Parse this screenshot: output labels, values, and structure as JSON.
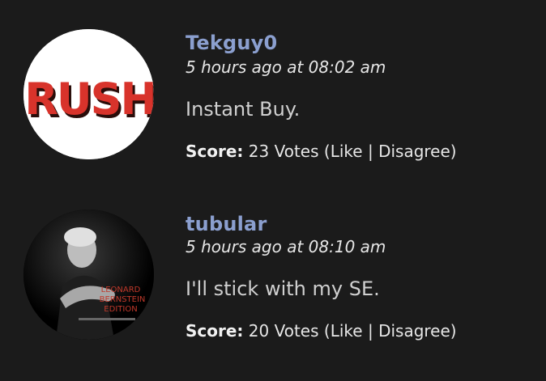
{
  "comments": [
    {
      "username": "Tekguy0",
      "timestamp": "5 hours ago at 08:02 am",
      "body": "Instant Buy.",
      "score_label": "Score:",
      "votes": "23 Votes",
      "like_label": "Like",
      "disagree_label": "Disagree",
      "avatar": {
        "icon": "rush-logo-avatar",
        "text": "RUSH",
        "background": "#ffffff",
        "text_color": "#d8332b"
      }
    },
    {
      "username": "tubular",
      "timestamp": "5 hours ago at 08:10 am",
      "body": "I'll stick with my SE.",
      "score_label": "Score:",
      "votes": "20 Votes",
      "like_label": "Like",
      "disagree_label": "Disagree",
      "avatar": {
        "icon": "album-cover-avatar",
        "text": "LEONARD BERNSTEIN EDITION",
        "background": "#000000",
        "text_color": "#c0392b"
      }
    }
  ],
  "colors": {
    "page_background": "#1b1b1b",
    "username": "#8b9fcf",
    "text": "#d0d0d0"
  }
}
